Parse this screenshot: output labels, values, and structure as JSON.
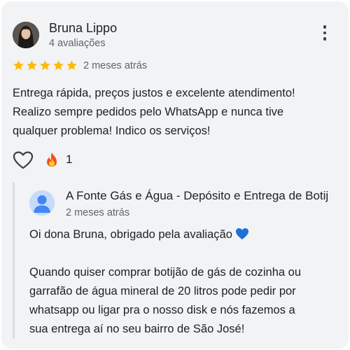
{
  "review": {
    "author_name": "Bruna Lippo",
    "author_reviews": "4 avaliações",
    "rating": 5,
    "rating_max": 5,
    "date": "2 meses atrás",
    "text_lines": [
      "Entrega rápida, preços justos e excelente atendimento!",
      "Realizo sempre pedidos pelo WhatsApp e nunca tive",
      "qualquer problema! Indico os serviços!"
    ],
    "reaction_count": "1"
  },
  "owner_reply": {
    "name": "A Fonte Gás e Água - Depósito e Entrega de Botij",
    "date": "2 meses atrás",
    "greeting": "Oi dona Bruna, obrigado pela avaliação",
    "body_lines": [
      "Quando quiser comprar botijão de gás de cozinha ou",
      "garrafão de água mineral de 20 litros pode pedir por",
      "whatsapp ou ligar pra o nosso disk e nós fazemos a",
      "sua entrega aí no seu bairro de São José!"
    ]
  },
  "colors": {
    "star": "#fbbc04",
    "card_bg": "#f1f3f4",
    "secondary_text": "#5f6368",
    "blue_heart": "#1e6fd9"
  },
  "icons": [
    "more-vert-icon",
    "star-icon",
    "heart-outline-icon",
    "fire-emoji-icon",
    "person-icon",
    "blue-heart-emoji-icon"
  ]
}
